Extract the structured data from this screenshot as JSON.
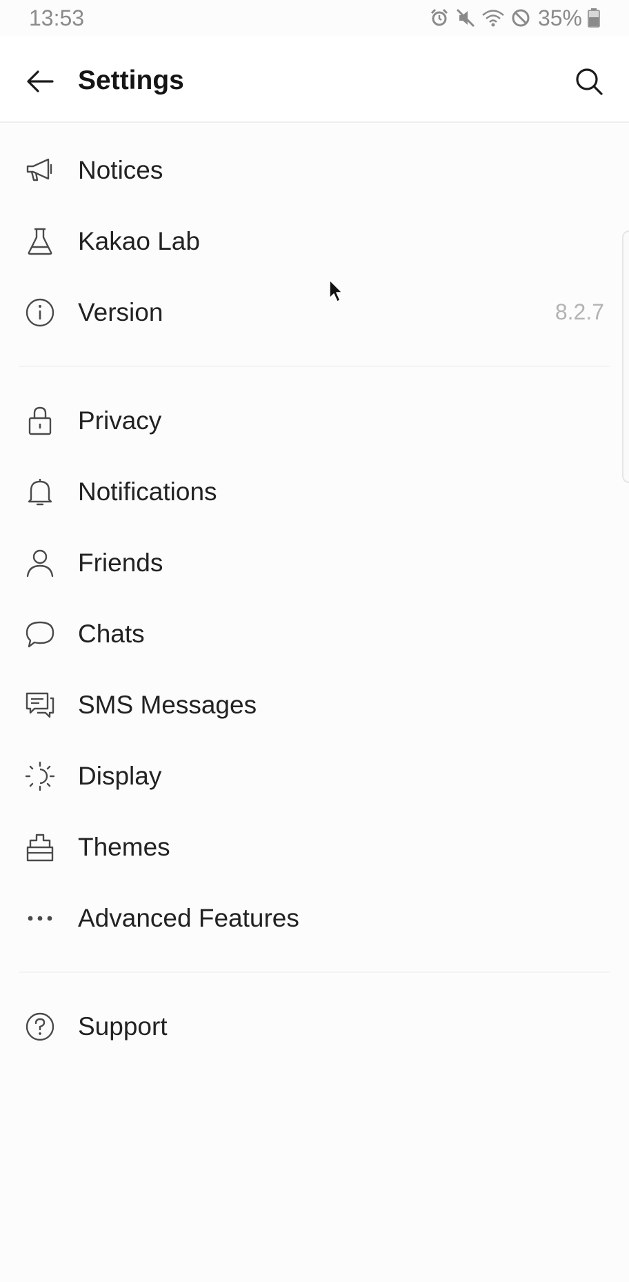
{
  "status_bar": {
    "time": "13:53",
    "battery": "35%"
  },
  "header": {
    "title": "Settings"
  },
  "settings": {
    "group1": [
      {
        "label": "Notices",
        "icon": "megaphone-icon"
      },
      {
        "label": "Kakao Lab",
        "icon": "flask-icon"
      },
      {
        "label": "Version",
        "icon": "info-icon",
        "value": "8.2.7"
      }
    ],
    "group2": [
      {
        "label": "Privacy",
        "icon": "lock-icon"
      },
      {
        "label": "Notifications",
        "icon": "bell-icon"
      },
      {
        "label": "Friends",
        "icon": "person-icon"
      },
      {
        "label": "Chats",
        "icon": "chat-bubble-icon"
      },
      {
        "label": "SMS Messages",
        "icon": "sms-icon"
      },
      {
        "label": "Display",
        "icon": "display-brightness-icon"
      },
      {
        "label": "Themes",
        "icon": "paintbrush-icon"
      },
      {
        "label": "Advanced Features",
        "icon": "more-dots-icon"
      }
    ],
    "group3": [
      {
        "label": "Support",
        "icon": "help-icon"
      }
    ]
  },
  "colors": {
    "text": "#222222",
    "secondary_text": "#b3b3b3",
    "icon": "#4a4a4a",
    "background": "#fcfcfc"
  }
}
